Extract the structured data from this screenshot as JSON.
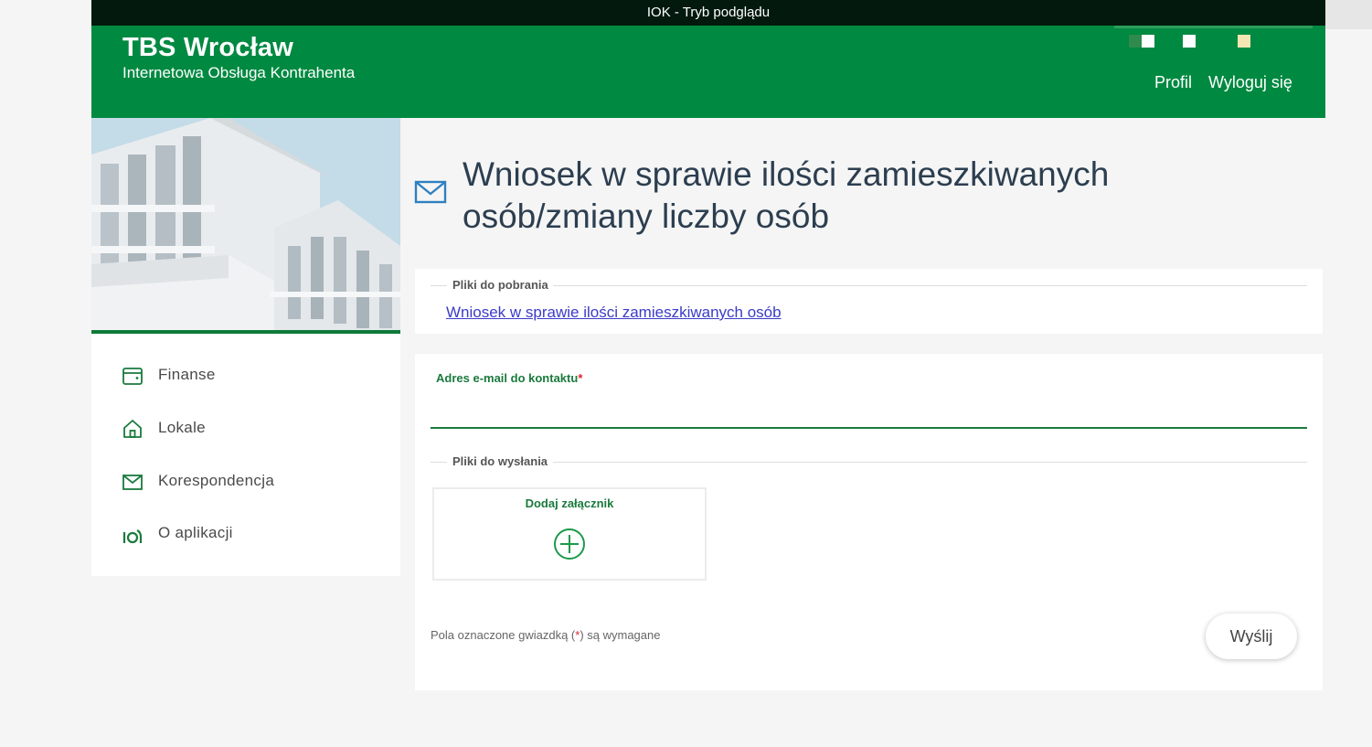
{
  "topbar": {
    "title": "IOK - Tryb podglądu"
  },
  "header": {
    "brand_title": "TBS Wrocław",
    "brand_subtitle": "Internetowa Obsługa Kontrahenta",
    "nav": {
      "profile": "Profil",
      "logout": "Wyloguj się"
    }
  },
  "sidebar": {
    "items": [
      {
        "label": "Finanse",
        "icon": "wallet-icon"
      },
      {
        "label": "Lokale",
        "icon": "home-icon"
      },
      {
        "label": "Korespondencja",
        "icon": "mail-icon"
      },
      {
        "label": "O aplikacji",
        "icon": "info-icon"
      }
    ]
  },
  "page": {
    "title": "Wniosek w sprawie ilości zamieszkiwanych osób/zmiany liczby osób",
    "title_icon": "envelope-icon"
  },
  "downloads": {
    "legend": "Pliki do pobrania",
    "link": "Wniosek w sprawie ilości zamieszkiwanych osób"
  },
  "form": {
    "email_label": "Adres e-mail do kontaktu",
    "required_mark": "*",
    "email_value": "",
    "uploads_legend": "Pliki do wysłania",
    "add_attachment": "Dodaj załącznik",
    "required_note_prefix": "Pola oznaczone gwiazdką (",
    "required_note_star": "*",
    "required_note_suffix": ") są wymagane",
    "submit_label": "Wyślij"
  },
  "colors": {
    "brand_green": "#008941",
    "dark_bar": "#03190d",
    "accent_green": "#1a7a3d",
    "link_blue": "#3b3bc8",
    "required_red": "#d9262c"
  }
}
